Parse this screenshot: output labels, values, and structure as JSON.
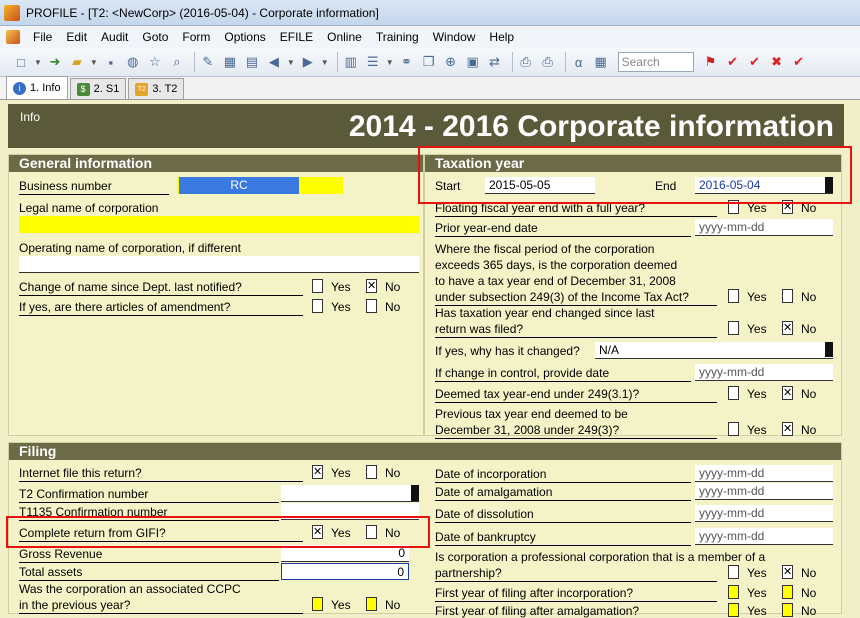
{
  "window": {
    "title": "PROFILE - [T2: <NewCorp> (2016-05-04) - Corporate information]"
  },
  "menu": [
    "File",
    "Edit",
    "Audit",
    "Goto",
    "Form",
    "Options",
    "EFILE",
    "Online",
    "Training",
    "Window",
    "Help"
  ],
  "toolbar": {
    "search_placeholder": "Search"
  },
  "tabs": [
    {
      "num": "1.",
      "label": "Info"
    },
    {
      "num": "2.",
      "label": "S1"
    },
    {
      "num": "3.",
      "label": "T2"
    }
  ],
  "header": {
    "info": "Info",
    "title": "2014 - 2016 Corporate information"
  },
  "general": {
    "title": "General information",
    "business_number_label": "Business number",
    "business_number_value": "RC",
    "legal_name_label": "Legal name of corporation",
    "operating_name_label": "Operating name of corporation, if different",
    "change_name_label": "Change of name since Dept. last notified?",
    "articles_label": "If yes, are there articles of amendment?"
  },
  "options": {
    "yes": "Yes",
    "no": "No"
  },
  "taxation": {
    "title": "Taxation year",
    "start_label": "Start",
    "start_value": "2015-05-05",
    "end_label": "End",
    "end_value": "2016-05-04",
    "floating_label": "Floating fiscal year end with a full year?",
    "prior_label": "Prior year-end date",
    "date_ph": "yyyy-mm-dd",
    "fiscal_l1": "Where the fiscal period of the corporation",
    "fiscal_l2": "exceeds 365 days, is the corporation deemed",
    "fiscal_l3": "to have a tax year end of December 31, 2008",
    "fiscal_l4": "under subsection 249(3) of the Income Tax Act?",
    "changed_l1": "Has taxation year end changed since last",
    "changed_l2": "return was filed?",
    "why_label": "If yes, why has it changed?",
    "why_value": "N/A",
    "control_label": "If change in control, provide date",
    "deemed_label": "Deemed tax year-end under 249(3.1)?",
    "prev_l1": "Previous tax year end deemed to be",
    "prev_l2": "December 31, 2008 under 249(3)?"
  },
  "filing": {
    "title": "Filing",
    "internet_label": "Internet file this return?",
    "t2conf_label": "T2 Confirmation number",
    "t1135_label": "T1135 Confirmation number",
    "gifi_label": "Complete return from GIFI?",
    "gross_label": "Gross Revenue",
    "gross_value": "0",
    "assets_label": "Total assets",
    "assets_value": "0",
    "ccpc_l1": "Was the corporation an associated CCPC",
    "ccpc_l2": "in the previous year?",
    "inc_label": "Date of incorporation",
    "amal_label": "Date of amalgamation",
    "diss_label": "Date of dissolution",
    "bank_label": "Date of bankruptcy",
    "prof_l1": "Is corporation a professional corporation that is a member of a",
    "prof_l2": "partnership?",
    "first_inc_label": "First year of filing after incorporation?",
    "first_amal_label": "First year of filing after amalgamation?"
  }
}
